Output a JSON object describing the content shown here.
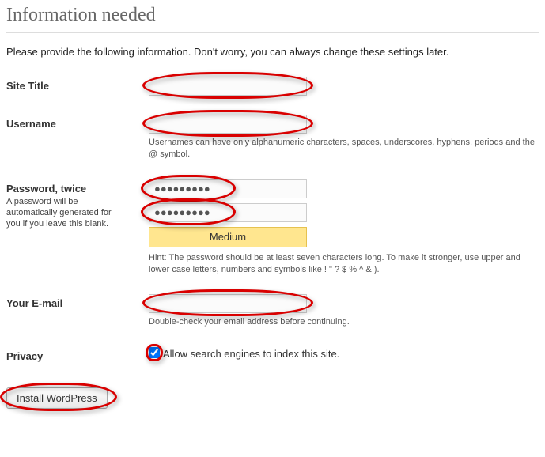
{
  "heading": "Information needed",
  "intro": "Please provide the following information. Don't worry, you can always change these settings later.",
  "fields": {
    "site_title": {
      "label": "Site Title",
      "value": ""
    },
    "username": {
      "label": "Username",
      "value": "",
      "desc": "Usernames can have only alphanumeric characters, spaces, underscores, hyphens, periods and the @ symbol."
    },
    "password": {
      "label": "Password, twice",
      "sub": "A password will be automatically generated for you if you leave this blank.",
      "value1": "●●●●●●●●●",
      "value2": "●●●●●●●●●",
      "strength": "Medium",
      "hint": "Hint: The password should be at least seven characters long. To make it stronger, use upper and lower case letters, numbers and symbols like ! \" ? $ % ^ & )."
    },
    "email": {
      "label": "Your E-mail",
      "value": "",
      "desc": "Double-check your email address before continuing."
    },
    "privacy": {
      "label": "Privacy",
      "checked": true,
      "text": "Allow search engines to index this site."
    }
  },
  "submit": "Install WordPress"
}
